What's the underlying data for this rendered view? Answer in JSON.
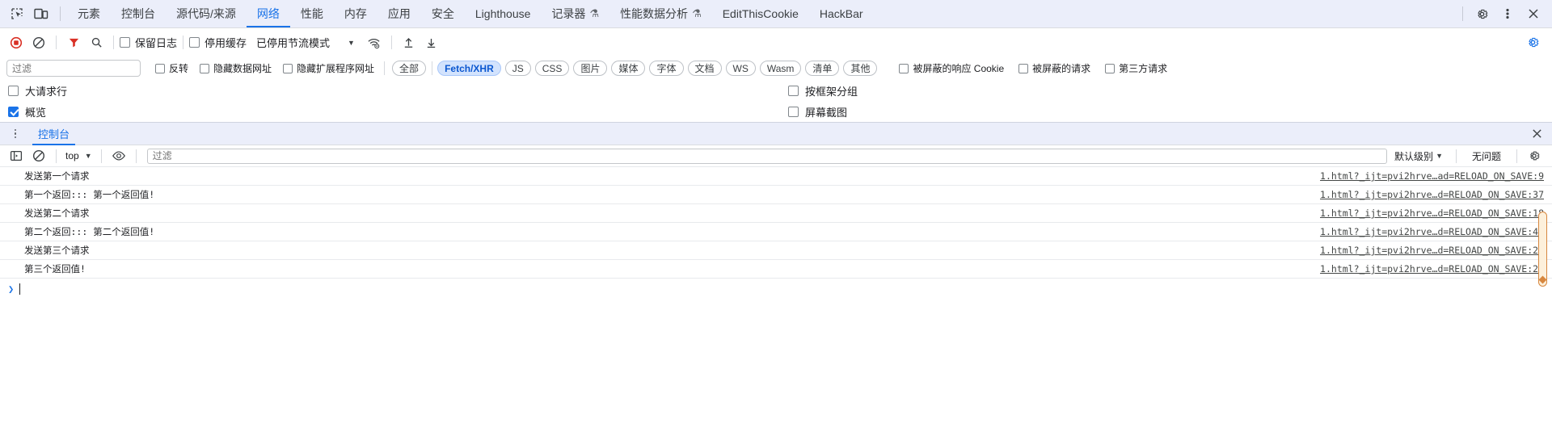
{
  "toptabs": {
    "icons": [
      "inspect-element-icon",
      "device-toolbar-icon"
    ],
    "items": [
      {
        "label": "元素",
        "active": false,
        "flask": false
      },
      {
        "label": "控制台",
        "active": false,
        "flask": false
      },
      {
        "label": "源代码/来源",
        "active": false,
        "flask": false
      },
      {
        "label": "网络",
        "active": true,
        "flask": false
      },
      {
        "label": "性能",
        "active": false,
        "flask": false
      },
      {
        "label": "内存",
        "active": false,
        "flask": false
      },
      {
        "label": "应用",
        "active": false,
        "flask": false
      },
      {
        "label": "安全",
        "active": false,
        "flask": false
      },
      {
        "label": "Lighthouse",
        "active": false,
        "flask": false
      },
      {
        "label": "记录器",
        "active": false,
        "flask": true
      },
      {
        "label": "性能数据分析",
        "active": false,
        "flask": true
      },
      {
        "label": "EditThisCookie",
        "active": false,
        "flask": false
      },
      {
        "label": "HackBar",
        "active": false,
        "flask": false
      }
    ],
    "right_icons": [
      "settings-gear-icon",
      "more-options-icon",
      "close-icon"
    ],
    "flask_glyph": "⚗"
  },
  "network_toolbar": {
    "record_title": "record-button",
    "clear_title": "clear-button",
    "filter_title": "filter-button",
    "search_title": "search-button",
    "preserve_log": "保留日志",
    "disable_cache": "停用缓存",
    "throttle_value": "已停用节流模式",
    "caret": "▼",
    "import_title": "import-har-button",
    "export_title": "export-har-button",
    "wifi_title": "network-conditions-icon",
    "settings_title": "network-settings-gear"
  },
  "filter_bar": {
    "filter_placeholder": "过滤",
    "filter_value": "",
    "invert": "反转",
    "hide_data_urls": "隐藏数据网址",
    "hide_ext_urls": "隐藏扩展程序网址",
    "types": [
      {
        "label": "全部",
        "active": false
      },
      {
        "label": "Fetch/XHR",
        "active": true
      },
      {
        "label": "JS",
        "active": false
      },
      {
        "label": "CSS",
        "active": false
      },
      {
        "label": "图片",
        "active": false
      },
      {
        "label": "媒体",
        "active": false
      },
      {
        "label": "字体",
        "active": false
      },
      {
        "label": "文档",
        "active": false
      },
      {
        "label": "WS",
        "active": false
      },
      {
        "label": "Wasm",
        "active": false
      },
      {
        "label": "清单",
        "active": false
      },
      {
        "label": "其他",
        "active": false
      }
    ],
    "blocked_cookies": "被屏蔽的响应 Cookie",
    "blocked_requests": "被屏蔽的请求",
    "third_party": "第三方请求"
  },
  "options_rows": [
    {
      "left_label": "大请求行",
      "left_checked": false,
      "right_label": "按框架分组",
      "right_checked": false
    },
    {
      "left_label": "概览",
      "left_checked": true,
      "right_label": "屏幕截图",
      "right_checked": false
    }
  ],
  "drawer": {
    "tab_label": "控制台",
    "close_glyph": "✕",
    "more_title": "drawer-more-options"
  },
  "console_toolbar": {
    "sidebar_title": "console-sidebar-toggle",
    "clear_title": "clear-console-button",
    "context": "top",
    "context_caret": "▼",
    "eye_title": "live-expression-icon",
    "filter_placeholder": "过滤",
    "filter_value": "",
    "level": "默认级别",
    "level_caret": "▼",
    "issues": "无问题",
    "settings_title": "console-settings-gear"
  },
  "console_messages": [
    {
      "text": "发送第一个请求",
      "link": "1.html?_ijt=pvi2hrve…ad=RELOAD_ON_SAVE:9"
    },
    {
      "text": "第一个返回::: 第一个返回值!",
      "link": "1.html?_ijt=pvi2hrve…d=RELOAD_ON_SAVE:37"
    },
    {
      "text": "发送第二个请求",
      "link": "1.html?_ijt=pvi2hrve…d=RELOAD_ON_SAVE:18"
    },
    {
      "text": "第二个返回::: 第二个返回值!",
      "link": "1.html?_ijt=pvi2hrve…d=RELOAD_ON_SAVE:40"
    },
    {
      "text": "发送第三个请求",
      "link": "1.html?_ijt=pvi2hrve…d=RELOAD_ON_SAVE:27"
    },
    {
      "text": "第三个返回值!",
      "link": "1.html?_ijt=pvi2hrve…d=RELOAD_ON_SAVE:29"
    }
  ],
  "prompt": {
    "arrow": "❯"
  },
  "colors": {
    "accent": "#1a73e8",
    "tabbar_bg": "#ebeefa",
    "record_red": "#d93025",
    "filter_red": "#d93025",
    "chip_active_bg": "#d3e3fd",
    "scroll_orange": "#d7873f"
  }
}
